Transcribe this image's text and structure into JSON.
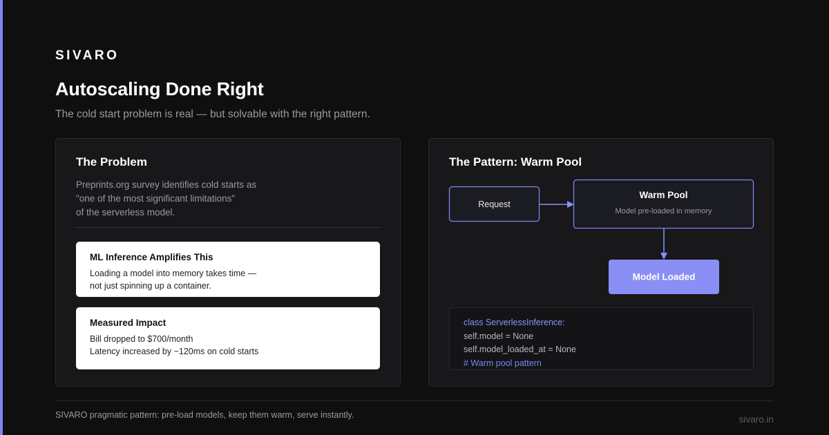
{
  "brand": "SIVARO",
  "title": "Autoscaling Done Right",
  "subtitle": "The cold start problem is real — but solvable with the right pattern.",
  "colors": {
    "background": "#0f0f10",
    "panel": "#18181a",
    "accent": "#7c86f0",
    "node_highlight": "#8a8ff5"
  },
  "problem": {
    "title": "The Problem",
    "quote_lines": [
      "Preprints.org survey identifies cold starts as",
      "\"one of the most significant limitations\"",
      "of the serverless model."
    ],
    "cards": [
      {
        "title": "ML Inference Amplifies This",
        "lines": [
          "Loading a model into memory takes time —",
          "not just spinning up a container."
        ]
      },
      {
        "title": "Measured Impact",
        "lines": [
          "Bill dropped to $700/month",
          "Latency increased by ~120ms on cold starts"
        ]
      }
    ]
  },
  "pattern": {
    "title": "The Pattern: Warm Pool",
    "nodes": {
      "request": "Request",
      "warm_pool_title": "Warm Pool",
      "warm_pool_sub": "Model pre-loaded in memory",
      "model_loaded": "Model Loaded"
    },
    "code_lines": [
      "class ServerlessInference:",
      "self.model = None",
      "self.model_loaded_at = None",
      "# Warm pool pattern"
    ]
  },
  "footer": {
    "text": "SIVARO pragmatic pattern: pre-load models, keep them warm, serve instantly.",
    "url": "sivaro.in"
  }
}
